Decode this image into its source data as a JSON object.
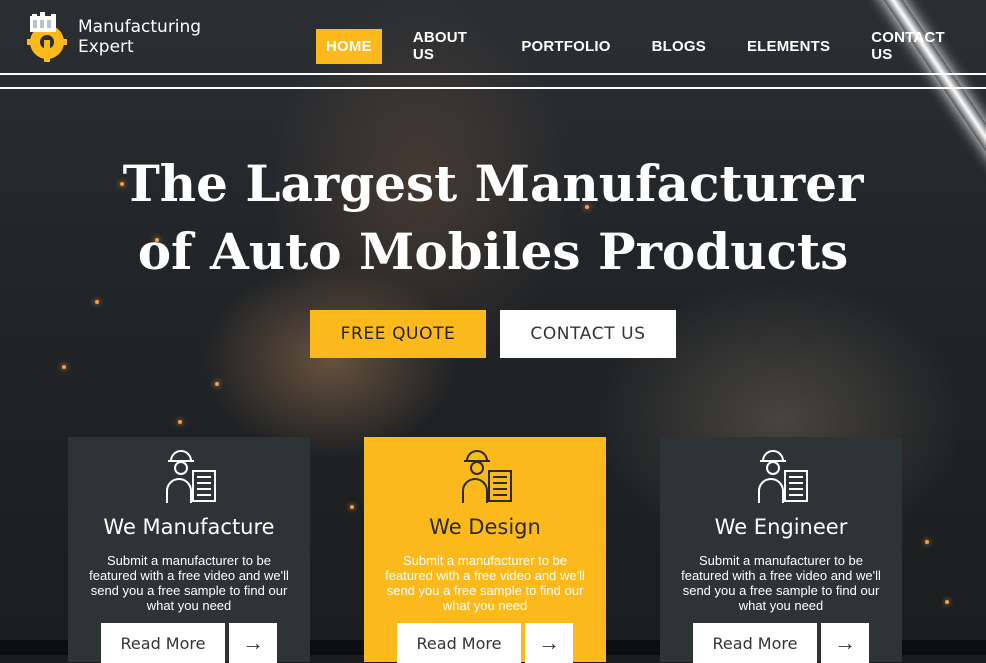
{
  "brand": {
    "name_line1": "Manufacturing",
    "name_line2": "Expert",
    "logo_icon": "gear-factory-icon"
  },
  "nav": {
    "items": [
      {
        "label": "HOME",
        "active": true
      },
      {
        "label": "ABOUT US",
        "active": false
      },
      {
        "label": "PORTFOLIO",
        "active": false
      },
      {
        "label": "BLOGS",
        "active": false
      },
      {
        "label": "ELEMENTS",
        "active": false
      },
      {
        "label": "CONTACT US",
        "active": false
      }
    ]
  },
  "hero": {
    "title_line1": "The Largest Manufacturer",
    "title_line2": "of Auto Mobiles Products",
    "primary_button": "FREE QUOTE",
    "secondary_button": "CONTACT US"
  },
  "cards": [
    {
      "title": "We Manufacture",
      "description": "Submit a manufacturer to be featured with a free video and we'll send you a free sample to find our what you need",
      "button": "Read More",
      "icon": "worker-icon",
      "arrow_icon": "arrow-right-icon"
    },
    {
      "title": "We Design",
      "description": "Submit a manufacturer to be featured with a free video and we'll send you a free sample to find our what you need",
      "button": "Read More",
      "icon": "worker-icon",
      "arrow_icon": "arrow-right-icon"
    },
    {
      "title": "We Engineer",
      "description": "Submit a manufacturer to be featured with a free video and we'll send you a free sample to find our what you need",
      "button": "Read More",
      "icon": "worker-icon",
      "arrow_icon": "arrow-right-icon"
    }
  ],
  "colors": {
    "accent": "#fbb91c",
    "card_dark": "#2e3336",
    "text_light": "#ffffff"
  }
}
